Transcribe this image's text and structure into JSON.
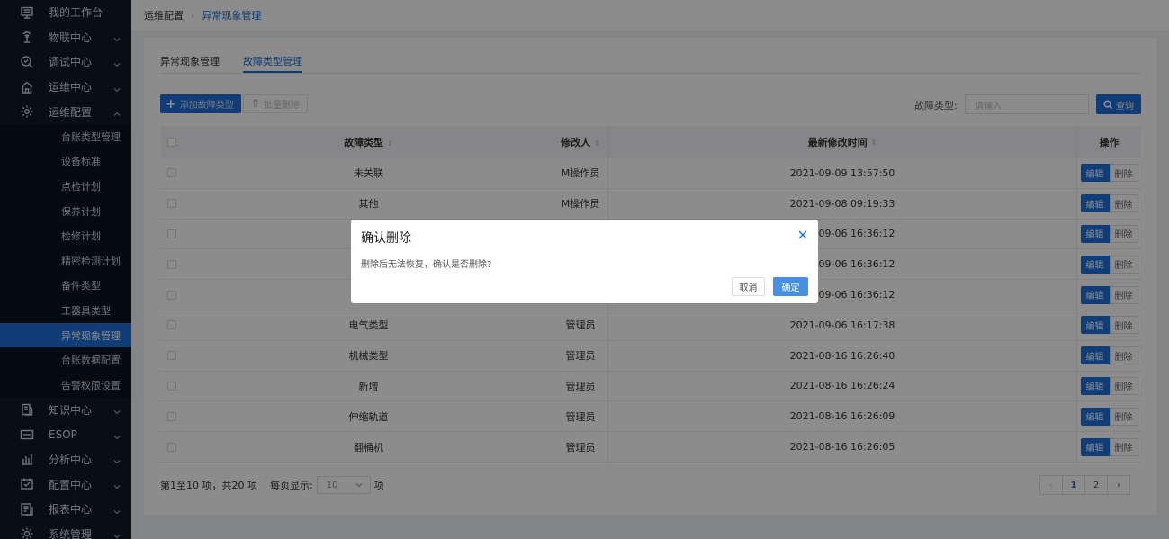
{
  "sidebar": {
    "menu_top": [
      {
        "label": "我的工作台",
        "icon": "monitor-icon",
        "chevron": false
      },
      {
        "label": "物联中心",
        "icon": "antenna-icon",
        "chevron": true
      },
      {
        "label": "调试中心",
        "icon": "debug-search-icon",
        "chevron": true
      },
      {
        "label": "运维中心",
        "icon": "home-icon",
        "chevron": true
      },
      {
        "label": "运维配置",
        "icon": "settings-icon",
        "chevron": true,
        "expanded": true
      }
    ],
    "submenu": [
      {
        "label": "台账类型管理",
        "active": false
      },
      {
        "label": "设备标准",
        "active": false
      },
      {
        "label": "点检计划",
        "active": false
      },
      {
        "label": "保养计划",
        "active": false
      },
      {
        "label": "检修计划",
        "active": false
      },
      {
        "label": "精密检测计划",
        "active": false
      },
      {
        "label": "备件类型",
        "active": false
      },
      {
        "label": "工器具类型",
        "active": false
      },
      {
        "label": "异常现象管理",
        "active": true
      },
      {
        "label": "台账数据配置",
        "active": false
      },
      {
        "label": "告警权限设置",
        "active": false
      }
    ],
    "menu_bottom": [
      {
        "label": "知识中心",
        "icon": "book-icon",
        "chevron": true
      },
      {
        "label": "ESOP",
        "icon": "esop-icon",
        "chevron": true
      },
      {
        "label": "分析中心",
        "icon": "bar-chart-icon",
        "chevron": true
      },
      {
        "label": "配置中心",
        "icon": "config-icon",
        "chevron": true
      },
      {
        "label": "报表中心",
        "icon": "report-icon",
        "chevron": true
      },
      {
        "label": "系统管理",
        "icon": "system-gear-icon",
        "chevron": true
      }
    ]
  },
  "breadcrumb": {
    "home": "运维配置",
    "current": "异常现象管理"
  },
  "tabs": [
    {
      "label": "异常现象管理",
      "active": false
    },
    {
      "label": "故障类型管理",
      "active": true
    }
  ],
  "toolbar": {
    "add_label": "添加故障类型",
    "batch_delete_label": "批量删除",
    "filter_label": "故障类型:",
    "filter_placeholder": "请输入",
    "query_label": "查询"
  },
  "table": {
    "headers": {
      "type": "故障类型",
      "user": "修改人",
      "time": "最新修改时间",
      "ops": "操作"
    },
    "rows": [
      {
        "type": "未关联",
        "user": "M操作员",
        "time": "2021-09-09 13:57:50"
      },
      {
        "type": "其他",
        "user": "M操作员",
        "time": "2021-09-08 09:19:33"
      },
      {
        "type": "",
        "user": "",
        "time": "2021-09-06 16:36:12"
      },
      {
        "type": "",
        "user": "",
        "time": "2021-09-06 16:36:12"
      },
      {
        "type": "",
        "user": "",
        "time": "2021-09-06 16:36:12"
      },
      {
        "type": "电气类型",
        "user": "管理员",
        "time": "2021-09-06 16:17:38"
      },
      {
        "type": "机械类型",
        "user": "管理员",
        "time": "2021-08-16 16:26:40"
      },
      {
        "type": "新增",
        "user": "管理员",
        "time": "2021-08-16 16:26:24"
      },
      {
        "type": "伸缩轨道",
        "user": "管理员",
        "time": "2021-08-16 16:26:09"
      },
      {
        "type": "翻桶机",
        "user": "管理员",
        "time": "2021-08-16 16:26:05"
      }
    ],
    "edit_label": "编辑",
    "delete_label": "删除"
  },
  "footer": {
    "summary": "第1至10 项，共20 项",
    "per_page_label": "每页显示:",
    "per_page_value": "10",
    "per_page_suffix": "项",
    "pages": [
      "1",
      "2"
    ],
    "current_page": "1"
  },
  "modal": {
    "title": "确认删除",
    "message": "删除后无法恢复，确认是否删除?",
    "cancel_label": "取消",
    "ok_label": "确定"
  },
  "colors": {
    "primary": "#1e6fd9",
    "sidebar_bg": "#0f1b2d",
    "overlay": "rgba(0,0,0,0.45)"
  }
}
